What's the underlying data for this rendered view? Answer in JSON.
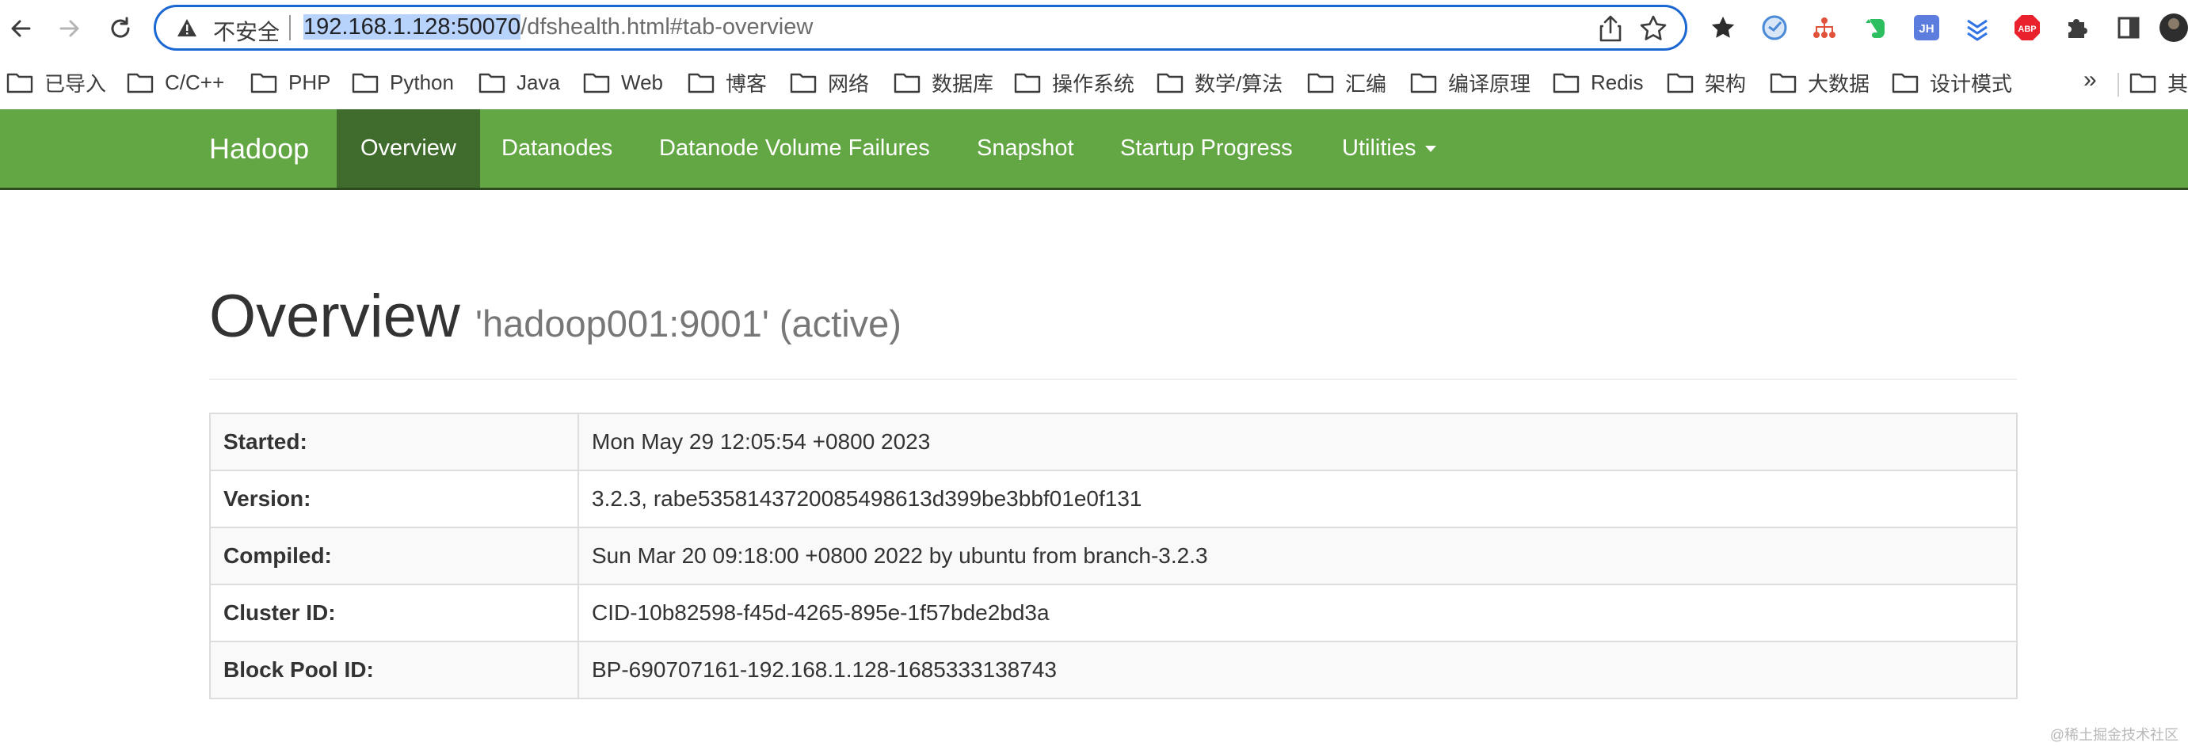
{
  "browser": {
    "insecure_label": "不安全",
    "url_host": "192.168.1.128:50070",
    "url_path": "/dfshealth.html#tab-overview",
    "extensions": [
      "star-icon",
      "vpn-icon",
      "network-icon",
      "evernote-icon",
      "jh-icon",
      "download-icon",
      "abp-icon",
      "puzzle-icon",
      "sidepanel-icon",
      "profile-icon"
    ],
    "extension_labels": {
      "jh": "JH",
      "abp": "ABP"
    }
  },
  "bookmarks": {
    "items": [
      "已导入",
      "C/C++",
      "PHP",
      "Python",
      "Java",
      "Web",
      "博客",
      "网络",
      "数据库",
      "操作系统",
      "数学/算法",
      "汇编",
      "编译原理",
      "Redis",
      "架构",
      "大数据",
      "设计模式"
    ],
    "more": "»",
    "other": "其"
  },
  "navbar": {
    "brand": "Hadoop",
    "items": [
      "Overview",
      "Datanodes",
      "Datanode Volume Failures",
      "Snapshot",
      "Startup Progress",
      "Utilities"
    ],
    "active_index": 0,
    "color": "#62a744",
    "active_color": "#3f6c2c"
  },
  "page": {
    "title": "Overview",
    "subtitle": "'hadoop001:9001' (active)"
  },
  "overview_table": [
    {
      "label": "Started:",
      "value": "Mon May 29 12:05:54 +0800 2023"
    },
    {
      "label": "Version:",
      "value": "3.2.3, rabe5358143720085498613d399be3bbf01e0f131"
    },
    {
      "label": "Compiled:",
      "value": "Sun Mar 20 09:18:00 +0800 2022 by ubuntu from branch-3.2.3"
    },
    {
      "label": "Cluster ID:",
      "value": "CID-10b82598-f45d-4265-895e-1f57bde2bd3a"
    },
    {
      "label": "Block Pool ID:",
      "value": "BP-690707161-192.168.1.128-1685333138743"
    }
  ],
  "watermark": "@稀土掘金技术社区"
}
